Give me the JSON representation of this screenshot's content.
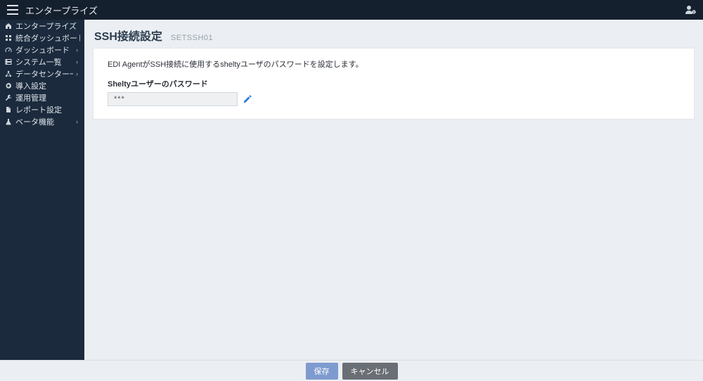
{
  "header": {
    "app_title": "エンタープライズ"
  },
  "sidebar": {
    "items": [
      {
        "icon": "home",
        "label": "エンタープライズ",
        "expandable": false
      },
      {
        "icon": "grid",
        "label": "統合ダッシュボード",
        "expandable": false
      },
      {
        "icon": "gauge",
        "label": "ダッシュボード",
        "expandable": true
      },
      {
        "icon": "server",
        "label": "システム一覧",
        "expandable": true
      },
      {
        "icon": "network",
        "label": "データセンター一覧",
        "expandable": true
      },
      {
        "icon": "gear",
        "label": "導入設定",
        "expandable": false
      },
      {
        "icon": "wrench",
        "label": "運用管理",
        "expandable": false
      },
      {
        "icon": "file",
        "label": "レポート設定",
        "expandable": false
      },
      {
        "icon": "flask",
        "label": "ベータ機能",
        "expandable": true
      }
    ]
  },
  "page": {
    "title": "SSH接続設定",
    "code": "SETSSH01",
    "description": "EDI AgentがSSH接続に使用するsheltyユーザのパスワードを設定します。",
    "field_label": "Sheltyユーザーのパスワード",
    "password_value": "***"
  },
  "footer": {
    "save_label": "保存",
    "cancel_label": "キャンセル"
  }
}
